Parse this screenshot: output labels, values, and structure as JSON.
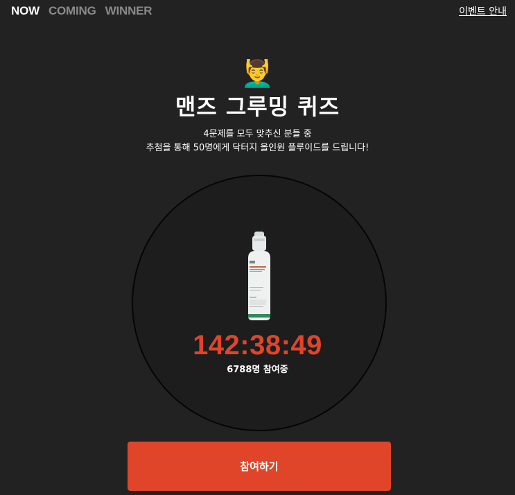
{
  "tabs": [
    {
      "label": "NOW",
      "active": true
    },
    {
      "label": "COMING",
      "active": false
    },
    {
      "label": "WINNER",
      "active": false
    }
  ],
  "guide_link": "이벤트 안내",
  "hero": {
    "emoji": "💆‍♂️",
    "title": "맨즈 그루밍 퀴즈",
    "description_line1": "4문제를 모두 맞추신 분들 중",
    "description_line2": "추첨을 통해 50명에게 닥터지 올인원 플루이드를 드립니다!"
  },
  "timer": "142:38:49",
  "participants": "6788명 참여중",
  "cta_label": "참여하기",
  "colors": {
    "background": "#222222",
    "accent": "#e0452a",
    "inactive_tab": "#8a8a8a"
  }
}
